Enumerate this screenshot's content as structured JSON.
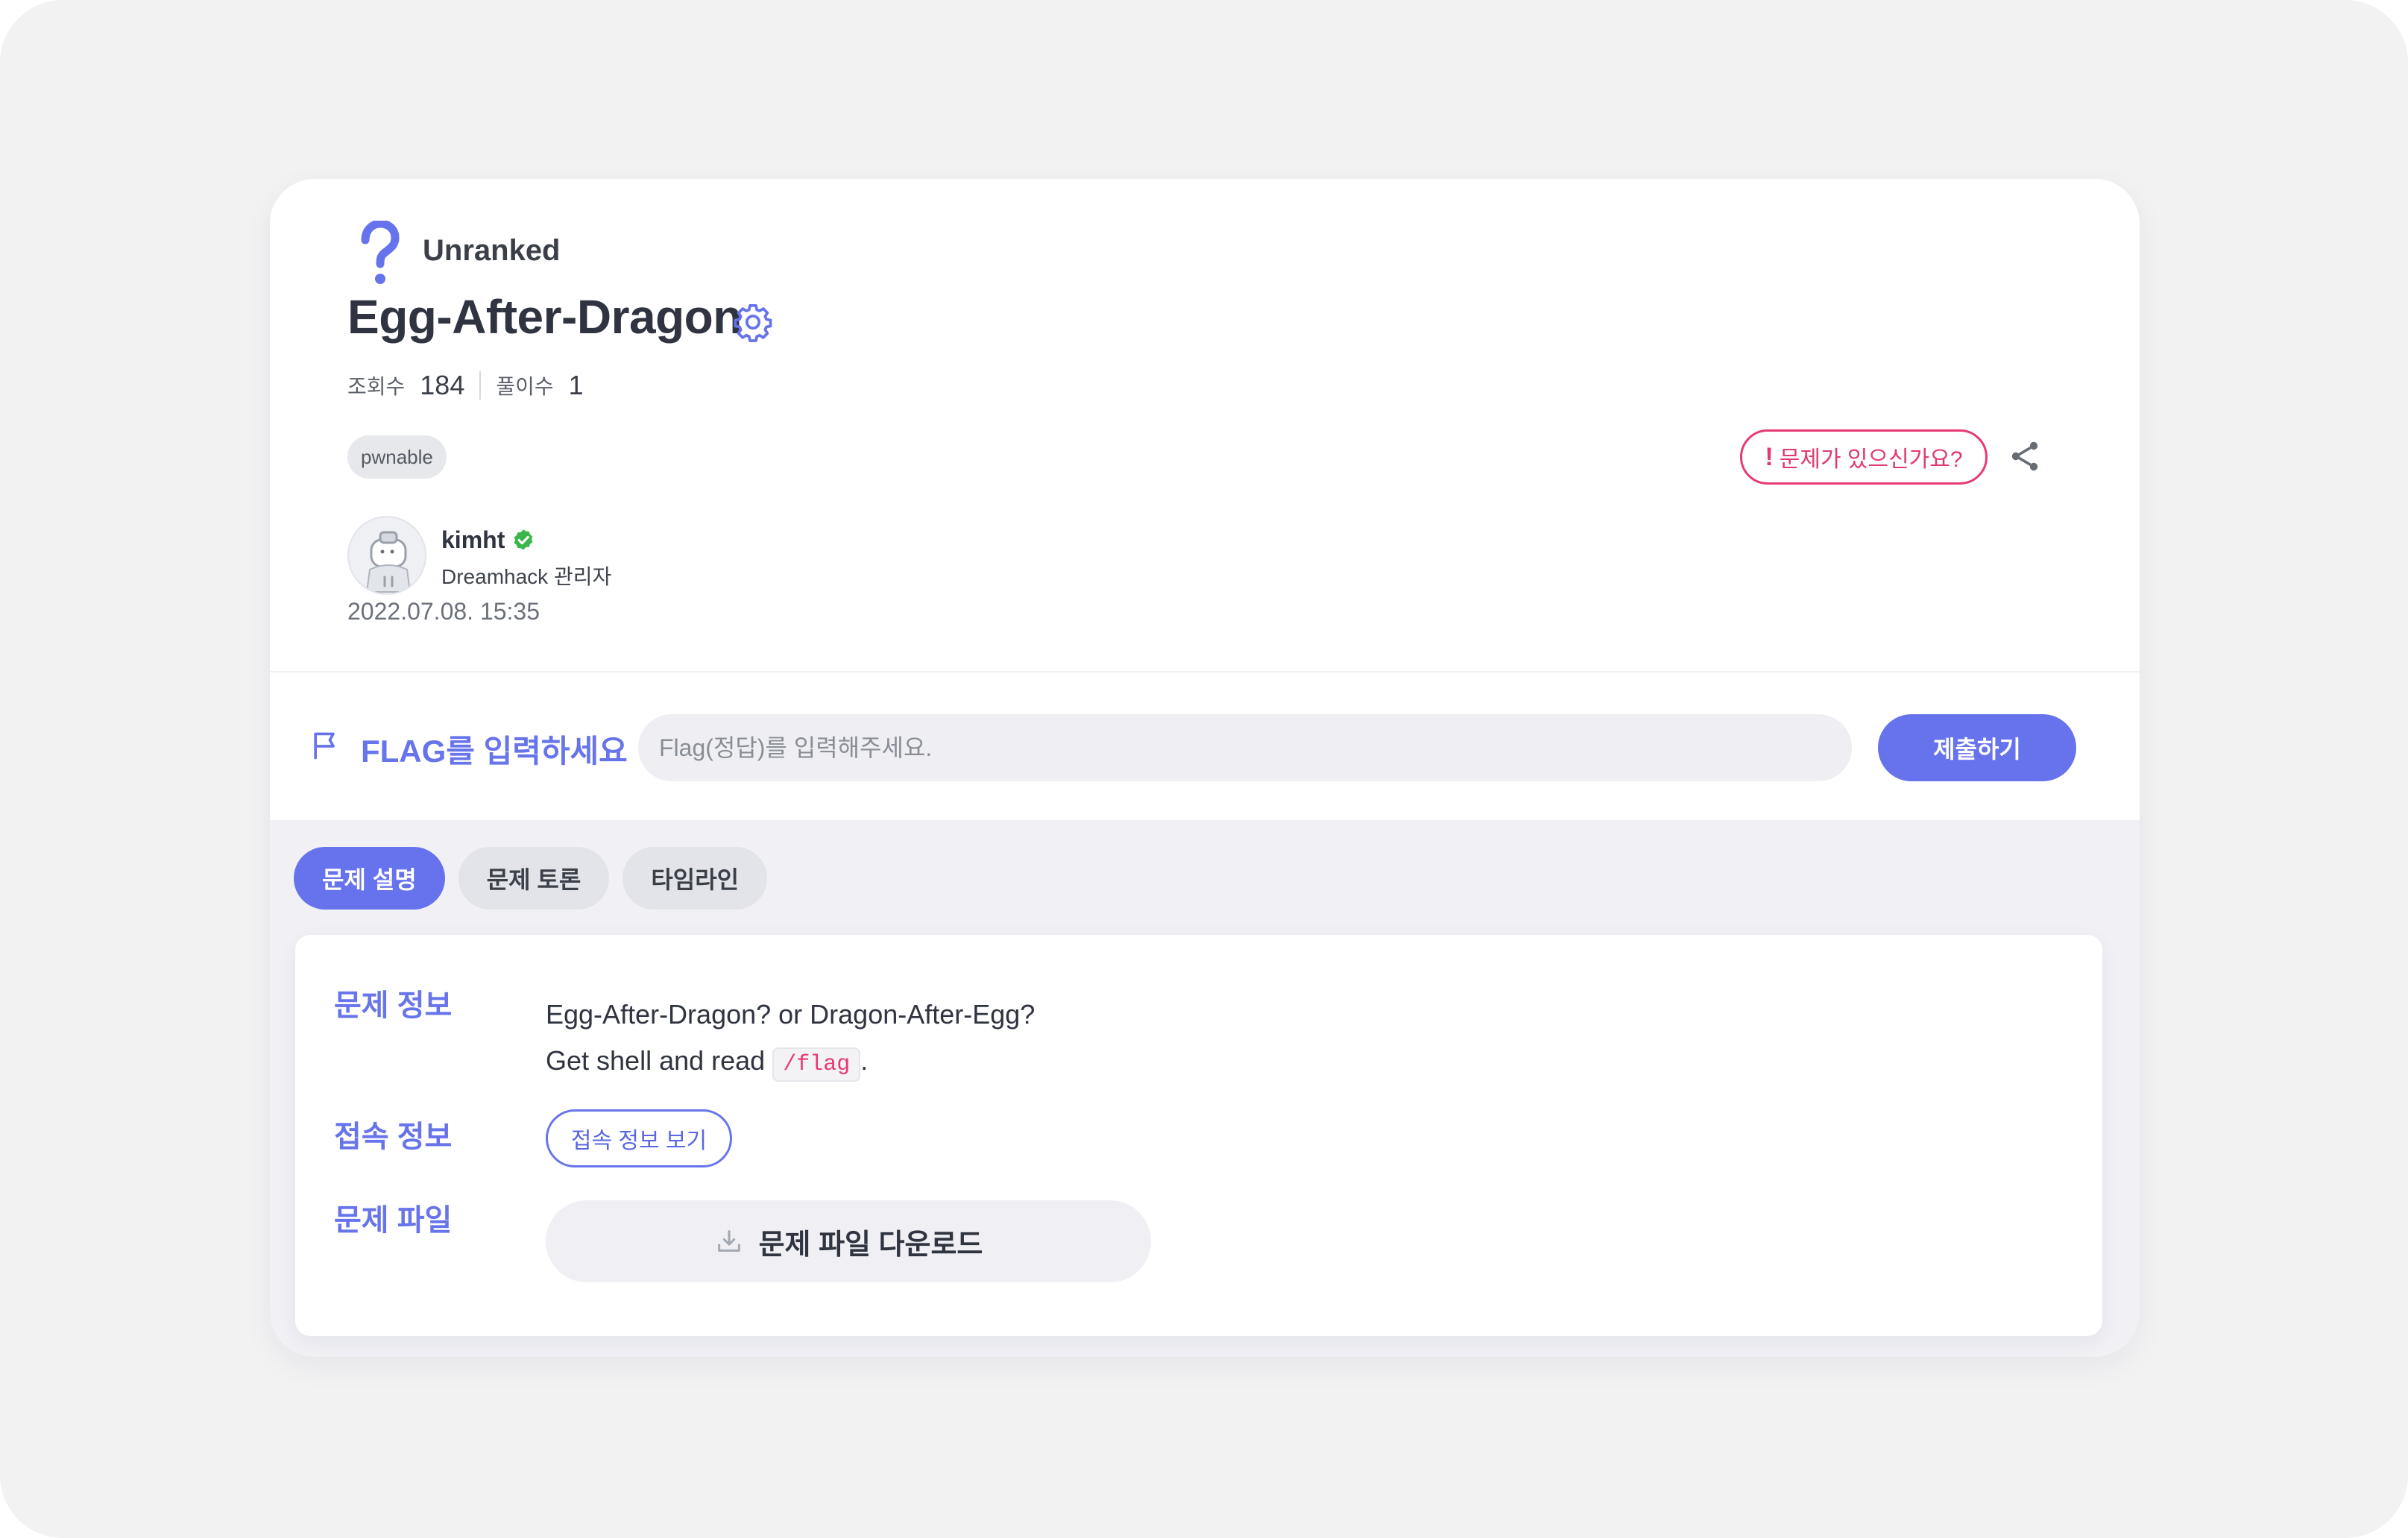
{
  "problem": {
    "rank_label": "Unranked",
    "title": "Egg-After-Dragon",
    "stats": {
      "views_label": "조회수",
      "views": "184",
      "solves_label": "풀이수",
      "solves": "1"
    },
    "tag": "pwnable",
    "report_label": "문제가 있으신가요?",
    "author": {
      "name": "kimht",
      "role": "Dreamhack 관리자"
    },
    "date": "2022.07.08. 15:35"
  },
  "flag": {
    "label": "FLAG를 입력하세요",
    "placeholder": "Flag(정답)를 입력해주세요.",
    "submit_label": "제출하기"
  },
  "tabs": [
    {
      "label": "문제 설명",
      "active": true
    },
    {
      "label": "문제 토론",
      "active": false
    },
    {
      "label": "타임라인",
      "active": false
    }
  ],
  "content": {
    "info_label": "문제 정보",
    "description_line1": "Egg-After-Dragon? or Dragon-After-Egg?",
    "description_line2_prefix": "Get shell and read",
    "description_code": "/flag",
    "description_line2_suffix": ".",
    "access_label": "접속 정보",
    "access_button": "접속 정보 보기",
    "file_label": "문제 파일",
    "download_button": "문제 파일 다운로드"
  },
  "colors": {
    "accent": "#6673ec",
    "report": "#e83a73",
    "verified": "#3cb54a",
    "background": "#f2f2f3"
  }
}
